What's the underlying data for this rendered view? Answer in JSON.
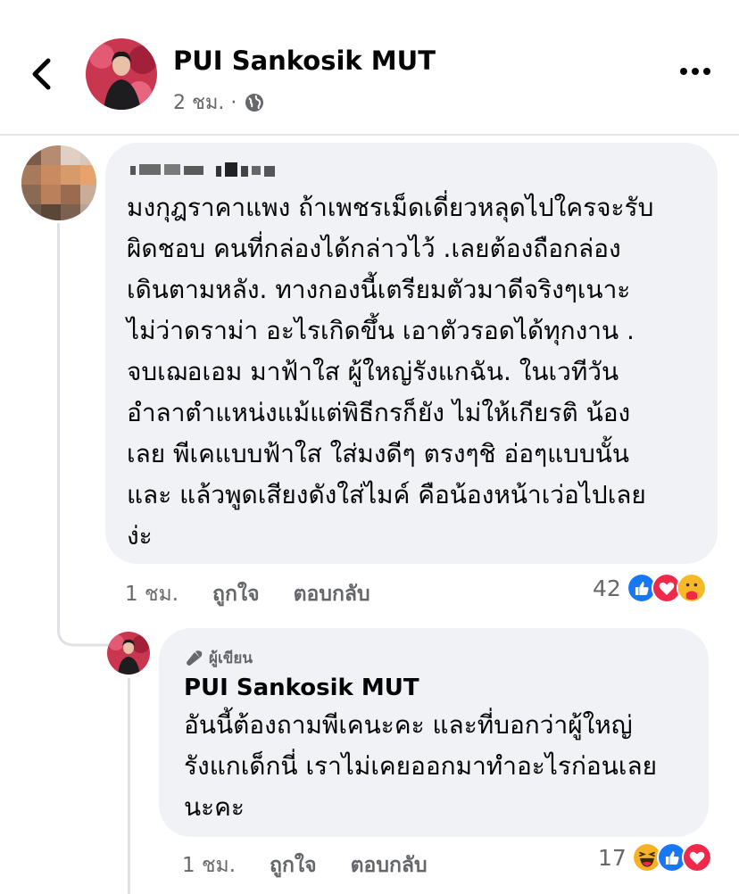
{
  "header": {
    "author_name": "PUI Sankosik MUT",
    "time": "2 ชม. ·"
  },
  "comment": {
    "text": "มงกุฎราคาแพง ถ้าเพชรเม็ดเดี่ยวหลุดไปใครจะรับ\nผิดชอบ คนที่กล่องได้กล่าวไว้ .เลยต้องถือกล่อง\nเดินตามหลัง. ทางกองนี้เตรียมตัวมาดีจริงๆเนาะ\nไม่ว่าดราม่า อะไรเกิดขึ้น เอาตัวรอดได้ทุกงาน .\nจบเฌอเอม มาฟ้าใส ผู้ใหญ่รังแกฉัน. ในเวทีวัน\nอำลาตำแหน่งแม้แต่พิธีกรก็ยัง ไม่ให้เกียรติ น้อง\nเลย พีเคแบบฟ้าใส ใส่มงดีๆ ตรงๆชิ อ่อๆแบบนั้น\nและ  แล้วพูดเสียงดังใส่ไมค์ คือน้องหน้าเว่อไปเลย\nง่ะ",
    "time": "1 ชม.",
    "like_label": "ถูกใจ",
    "reply_label": "ตอบกลับ",
    "reaction_count": "42",
    "reactions": [
      "like",
      "love",
      "care"
    ]
  },
  "reply": {
    "badge": "ผู้เขียน",
    "name": "PUI Sankosik MUT",
    "text": "อันนี้ต้องถามพีเคนะคะ และที่บอกว่าผู้ใหญ่\nรังแกเด็กนี่ เราไม่เคยออกมาทำอะไรก่อนเลย\nนะคะ",
    "time": "1 ชม.",
    "like_label": "ถูกใจ",
    "reply_label": "ตอบกลับ",
    "reaction_count": "17",
    "reactions": [
      "haha",
      "like",
      "love"
    ]
  },
  "colors": {
    "like": "#1877f2",
    "love": "#f02849",
    "haha": "#f7b125",
    "care": "#f7b928",
    "bubble": "#f0f2f5",
    "meta_text": "#65676b"
  }
}
